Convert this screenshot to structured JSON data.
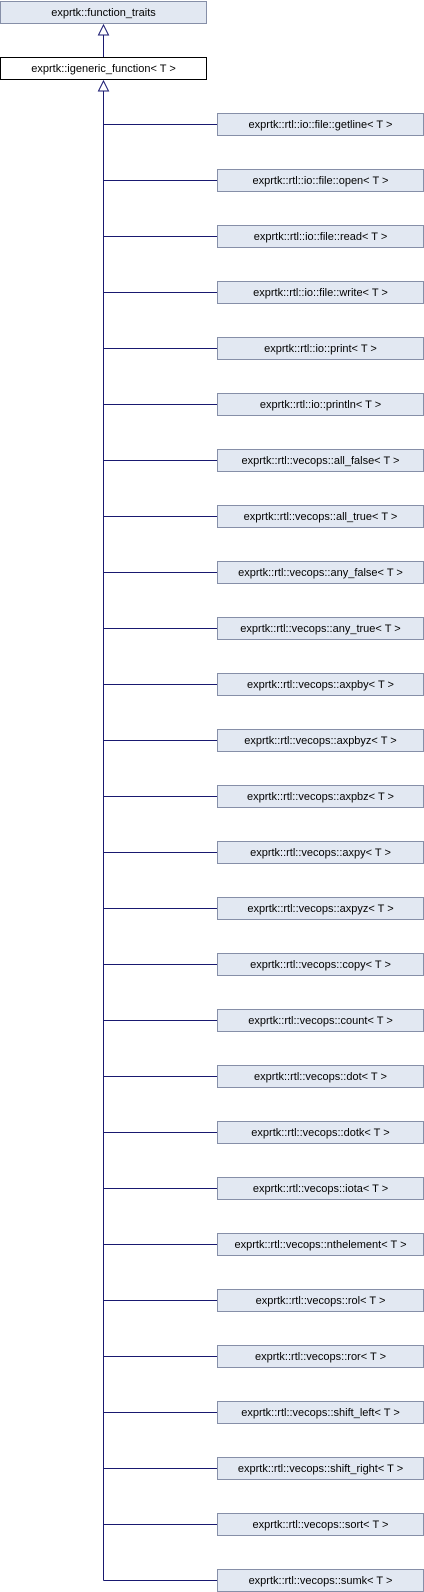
{
  "diagram": {
    "base_class": {
      "label": "exprtk::function_traits"
    },
    "focus_class": {
      "label": "exprtk::igeneric_function< T >"
    },
    "derived_classes": [
      "exprtk::rtl::io::file::getline< T >",
      "exprtk::rtl::io::file::open< T >",
      "exprtk::rtl::io::file::read< T >",
      "exprtk::rtl::io::file::write< T >",
      "exprtk::rtl::io::print< T >",
      "exprtk::rtl::io::println< T >",
      "exprtk::rtl::vecops::all_false< T >",
      "exprtk::rtl::vecops::all_true< T >",
      "exprtk::rtl::vecops::any_false< T >",
      "exprtk::rtl::vecops::any_true< T >",
      "exprtk::rtl::vecops::axpby< T >",
      "exprtk::rtl::vecops::axpbyz< T >",
      "exprtk::rtl::vecops::axpbz< T >",
      "exprtk::rtl::vecops::axpy< T >",
      "exprtk::rtl::vecops::axpyz< T >",
      "exprtk::rtl::vecops::copy< T >",
      "exprtk::rtl::vecops::count< T >",
      "exprtk::rtl::vecops::dot< T >",
      "exprtk::rtl::vecops::dotk< T >",
      "exprtk::rtl::vecops::iota< T >",
      "exprtk::rtl::vecops::nthelement< T >",
      "exprtk::rtl::vecops::rol< T >",
      "exprtk::rtl::vecops::ror< T >",
      "exprtk::rtl::vecops::shift_left< T >",
      "exprtk::rtl::vecops::shift_right< T >",
      "exprtk::rtl::vecops::sort< T >",
      "exprtk::rtl::vecops::sumk< T >"
    ],
    "colors": {
      "node_fill": "#e2e8f2",
      "node_border": "#868fa8",
      "focus_fill": "#ffffff",
      "focus_border": "#000000",
      "edge": "#191970"
    }
  }
}
